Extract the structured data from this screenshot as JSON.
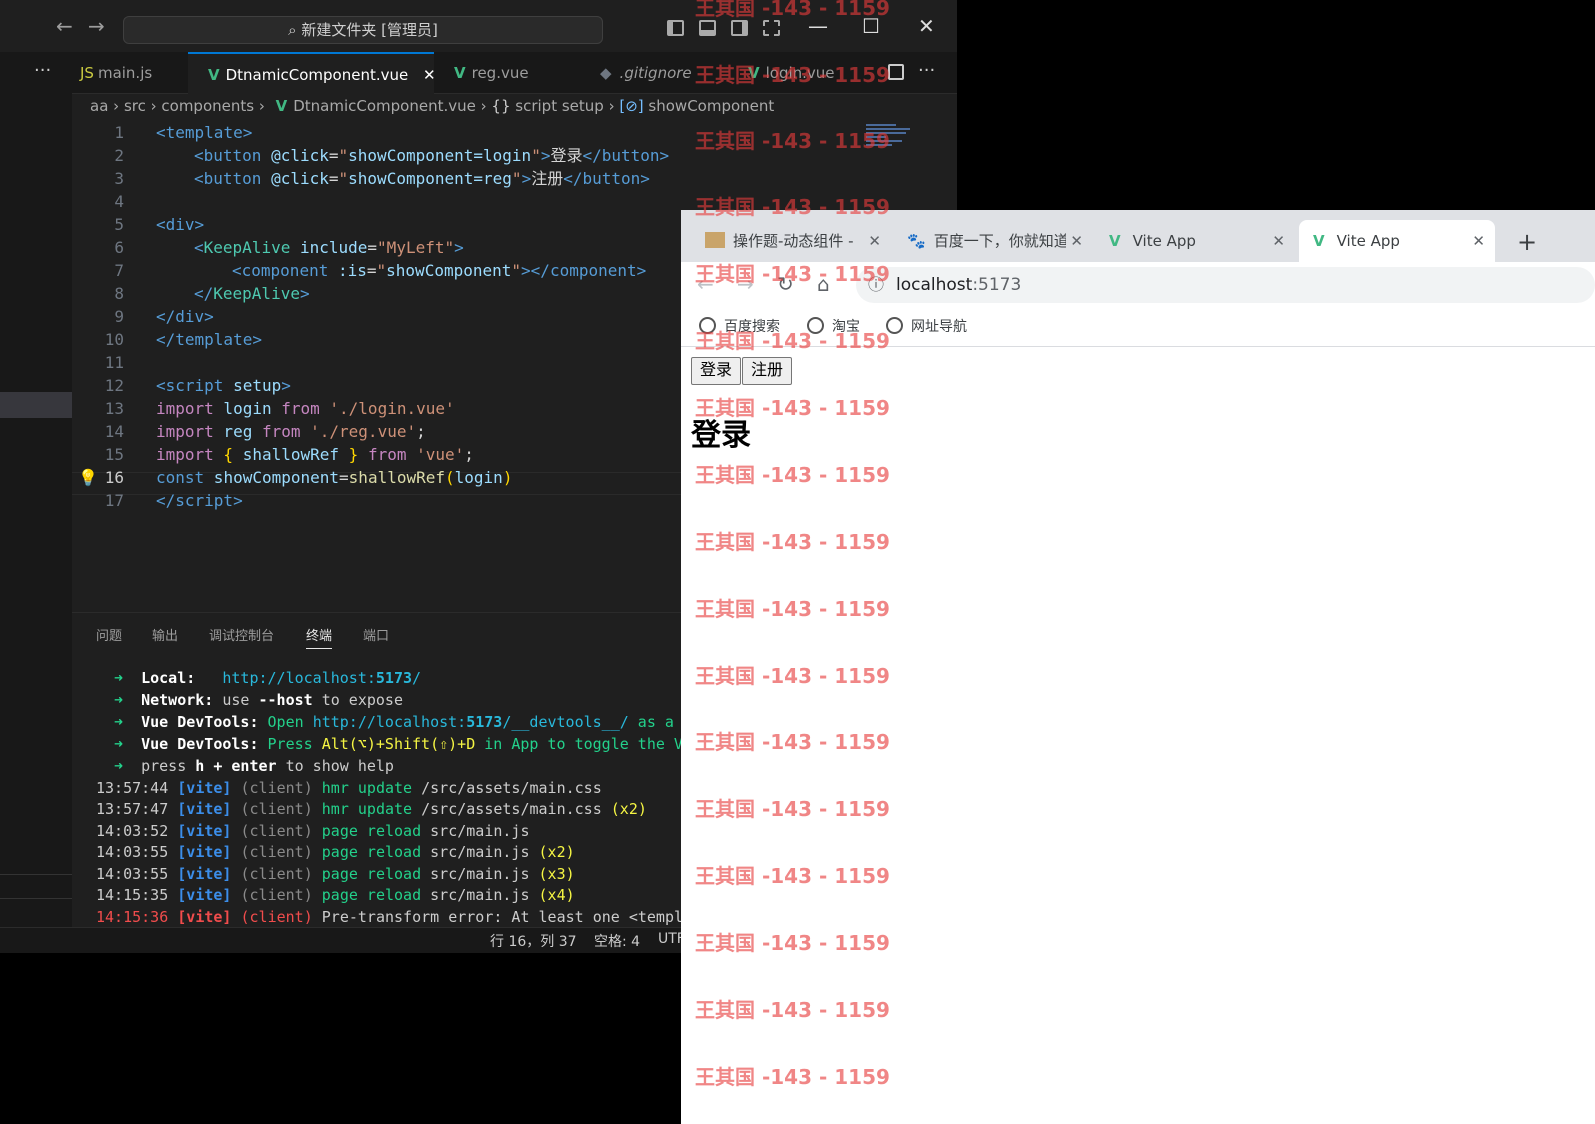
{
  "vscode": {
    "search_text": "新建文件夹 [管理员]",
    "tabs": [
      {
        "label": "main.js"
      },
      {
        "label": "DtnamicComponent.vue",
        "close": "✕"
      },
      {
        "label": "reg.vue"
      },
      {
        "label": ".gitignore"
      },
      {
        "label": "login.vue"
      }
    ],
    "breadcrumb": {
      "p1": "aa",
      "p2": "src",
      "p3": "components",
      "p4": "DtnamicComponent.vue",
      "p5": "script setup",
      "p6": "showComponent"
    },
    "line_numbers": [
      "1",
      "2",
      "3",
      "4",
      "5",
      "6",
      "7",
      "8",
      "9",
      "10",
      "11",
      "12",
      "13",
      "14",
      "15",
      "16",
      "17"
    ],
    "code": {
      "l1a": "<",
      "l1b": "template",
      "l1c": ">",
      "l2a": "<",
      "l2b": "button",
      "l2c": " @click",
      "l2d": "=",
      "l2e": "\"",
      "l2f": "showComponent=login",
      "l2g": "\"",
      "l2h": ">",
      "l2i": "登录",
      "l2j": "</",
      "l2k": "button",
      "l2l": ">",
      "l3a": "<",
      "l3b": "button",
      "l3c": " @click",
      "l3d": "=",
      "l3e": "\"",
      "l3f": "showComponent=reg",
      "l3g": "\"",
      "l3h": ">",
      "l3i": "注册",
      "l3j": "</",
      "l3k": "button",
      "l3l": ">",
      "l5a": "<",
      "l5b": "div",
      "l5c": ">",
      "l6a": "<",
      "l6b": "KeepAlive",
      "l6c": " include",
      "l6d": "=",
      "l6e": "\"MyLeft\"",
      "l6f": ">",
      "l7a": "<",
      "l7b": "component",
      "l7c": " :is",
      "l7d": "=",
      "l7e": "\"",
      "l7f": "showComponent",
      "l7g": "\"",
      "l7h": "></",
      "l7i": "component",
      "l7j": ">",
      "l8a": "</",
      "l8b": "KeepAlive",
      "l8c": ">",
      "l9a": "</",
      "l9b": "div",
      "l9c": ">",
      "l10a": "</",
      "l10b": "template",
      "l10c": ">",
      "l12a": "<",
      "l12b": "script",
      "l12c": " setup",
      "l12d": ">",
      "l13a": "import",
      "l13b": " login ",
      "l13c": "from",
      "l13d": " './login.vue'",
      "l14a": "import",
      "l14b": " reg ",
      "l14c": "from",
      "l14d": " './reg.vue'",
      "l14e": ";",
      "l15a": "import",
      "l15b": " { ",
      "l15c": "shallowRef",
      "l15d": " } ",
      "l15e": "from",
      "l15f": " 'vue'",
      "l15g": ";",
      "l16a": "const",
      "l16b": " showComponent",
      "l16c": "=",
      "l16d": "shallowRef",
      "l16e": "(",
      "l16f": "login",
      "l16g": ")",
      "l17a": "</",
      "l17b": "script",
      "l17c": ">"
    },
    "panel_tabs": [
      "问题",
      "输出",
      "调试控制台",
      "终端",
      "端口"
    ],
    "terminal": {
      "t1a": "➜ ",
      "t1b": " Local:",
      "t1c": "   http://localhost:",
      "t1d": "5173",
      "t1e": "/",
      "t2a": "➜ ",
      "t2b": " Network:",
      "t2c": " use ",
      "t2d": "--host",
      "t2e": " to expose",
      "t3a": "➜ ",
      "t3b": " Vue DevTools:",
      "t3c": " Open ",
      "t3d": "http://localhost:",
      "t3e": "5173",
      "t3f": "/__devtools__/",
      "t3g": " as a s",
      "t4a": "➜ ",
      "t4b": " Vue DevTools:",
      "t4c": " Press ",
      "t4d": "Alt(⌥)+Shift(⇧)+D",
      "t4e": " in App to toggle the Vu",
      "t5a": "➜ ",
      "t5b": " press ",
      "t5c": "h + enter",
      "t5d": " to show help",
      "lines": [
        {
          "time": "13:57:44",
          "tag": "[vite]",
          "cl": "(client)",
          "act": "hmr update",
          "file": "/src/assets/main.css",
          "cnt": ""
        },
        {
          "time": "13:57:47",
          "tag": "[vite]",
          "cl": "(client)",
          "act": "hmr update",
          "file": "/src/assets/main.css",
          "cnt": "(x2)"
        },
        {
          "time": "14:03:52",
          "tag": "[vite]",
          "cl": "(client)",
          "act": "page reload",
          "file": "src/main.js",
          "cnt": ""
        },
        {
          "time": "14:03:55",
          "tag": "[vite]",
          "cl": "(client)",
          "act": "page reload",
          "file": "src/main.js",
          "cnt": "(x2)"
        },
        {
          "time": "14:03:55",
          "tag": "[vite]",
          "cl": "(client)",
          "act": "page reload",
          "file": "src/main.js",
          "cnt": "(x3)"
        },
        {
          "time": "14:15:35",
          "tag": "[vite]",
          "cl": "(client)",
          "act": "page reload",
          "file": "src/main.js",
          "cnt": "(x4)"
        }
      ],
      "err": {
        "time": "14:15:36",
        "tag": "[vite]",
        "cl": "(client)",
        "msg": "Pre-transform error: At least one <templa"
      }
    },
    "status": {
      "pos": "行 16，列 37",
      "spaces": "空格: 4",
      "enc": "UTF"
    }
  },
  "chrome": {
    "tabs": [
      {
        "label": "操作题-动态组件 -"
      },
      {
        "label": "百度一下，你就知道"
      },
      {
        "label": "Vite App"
      },
      {
        "label": "Vite App"
      }
    ],
    "tab_close": "✕",
    "new_tab": "+",
    "address": {
      "host": "localhost",
      "port": ":5173"
    },
    "bookmarks": [
      "百度搜索",
      "淘宝",
      "网址导航"
    ],
    "buttons": {
      "login": "登录",
      "reg": "注册"
    },
    "heading": "登录"
  },
  "watermark": "王其国 -143 - 1159"
}
